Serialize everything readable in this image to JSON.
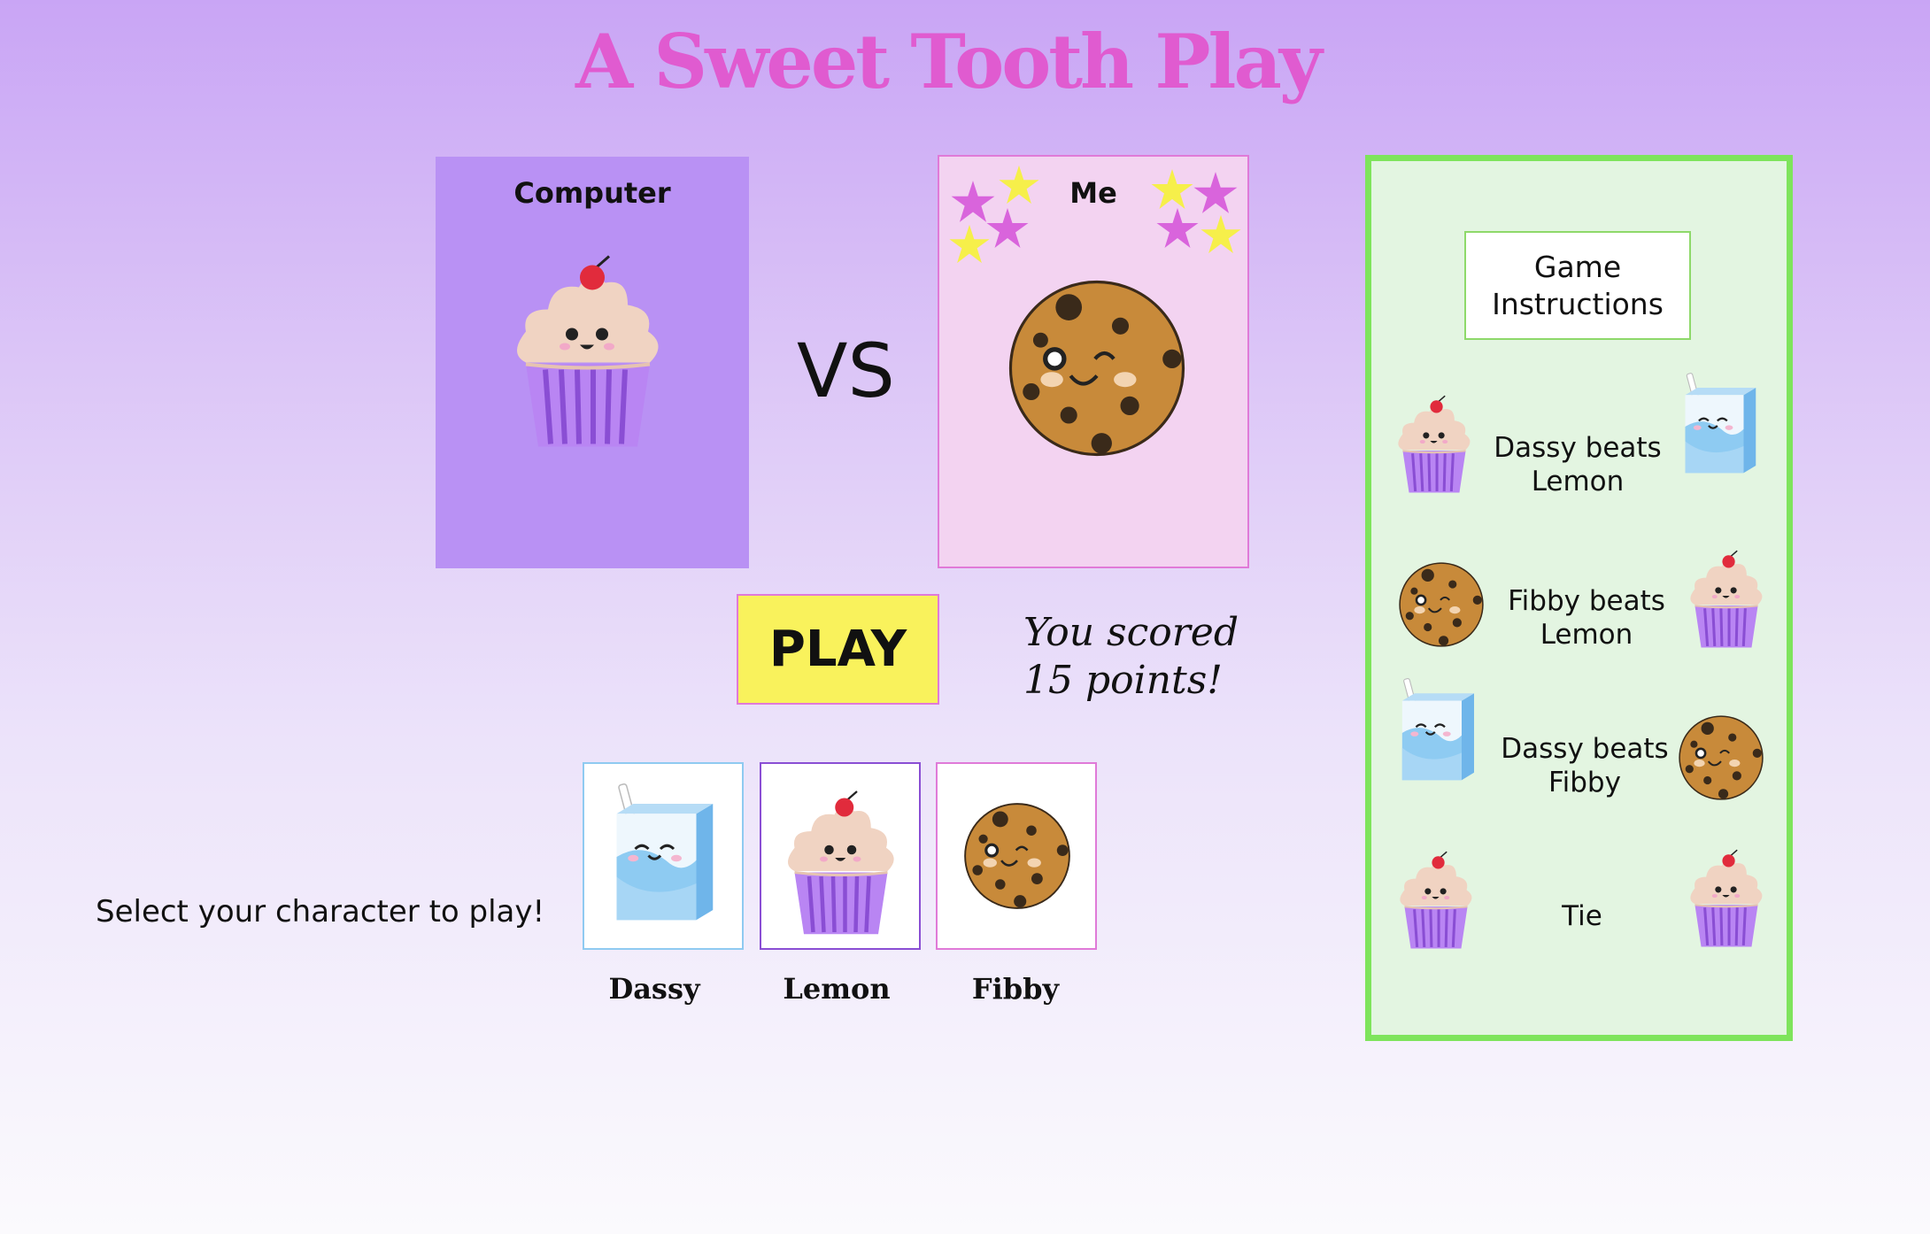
{
  "title": "A Sweet Tooth Play",
  "computer_card": {
    "label": "Computer",
    "character_icon": "cupcake-sad"
  },
  "me_card": {
    "label": "Me",
    "character_icon": "cookie-wink"
  },
  "vs_label": "VS",
  "play_button": "PLAY",
  "score_text": "You scored 15 points!",
  "select_prompt": "Select your character to play!",
  "characters": [
    {
      "name": "Dassy",
      "icon": "juice-box-icon",
      "border_color": "#8fcaf1"
    },
    {
      "name": "Lemon",
      "icon": "cupcake-icon",
      "border_color": "#8a4ed4"
    },
    {
      "name": "Fibby",
      "icon": "cookie-icon",
      "border_color": "#e07ad8"
    }
  ],
  "instructions": {
    "title": "Game Instructions",
    "rules": [
      {
        "text": "Dassy beats Lemon",
        "left_icon": "cupcake-icon",
        "right_icon": "juice-box-icon"
      },
      {
        "text": "Fibby beats Lemon",
        "left_icon": "cookie-icon",
        "right_icon": "cupcake-icon"
      },
      {
        "text": "Dassy beats Fibby",
        "left_icon": "juice-box-icon",
        "right_icon": "cookie-icon"
      },
      {
        "text": "Tie",
        "left_icon": "cupcake-icon",
        "right_icon": "cupcake-icon"
      }
    ]
  },
  "colors": {
    "title": "#e05bd0",
    "computer_card_bg": "#b991f4",
    "me_card_bg": "#f3d3f1",
    "play_button_bg": "#f9f25c",
    "instructions_bg": "#e3f5e1",
    "instructions_border": "#7ee45c",
    "star_pink": "#d964dc",
    "star_yellow": "#f6ef4a"
  }
}
